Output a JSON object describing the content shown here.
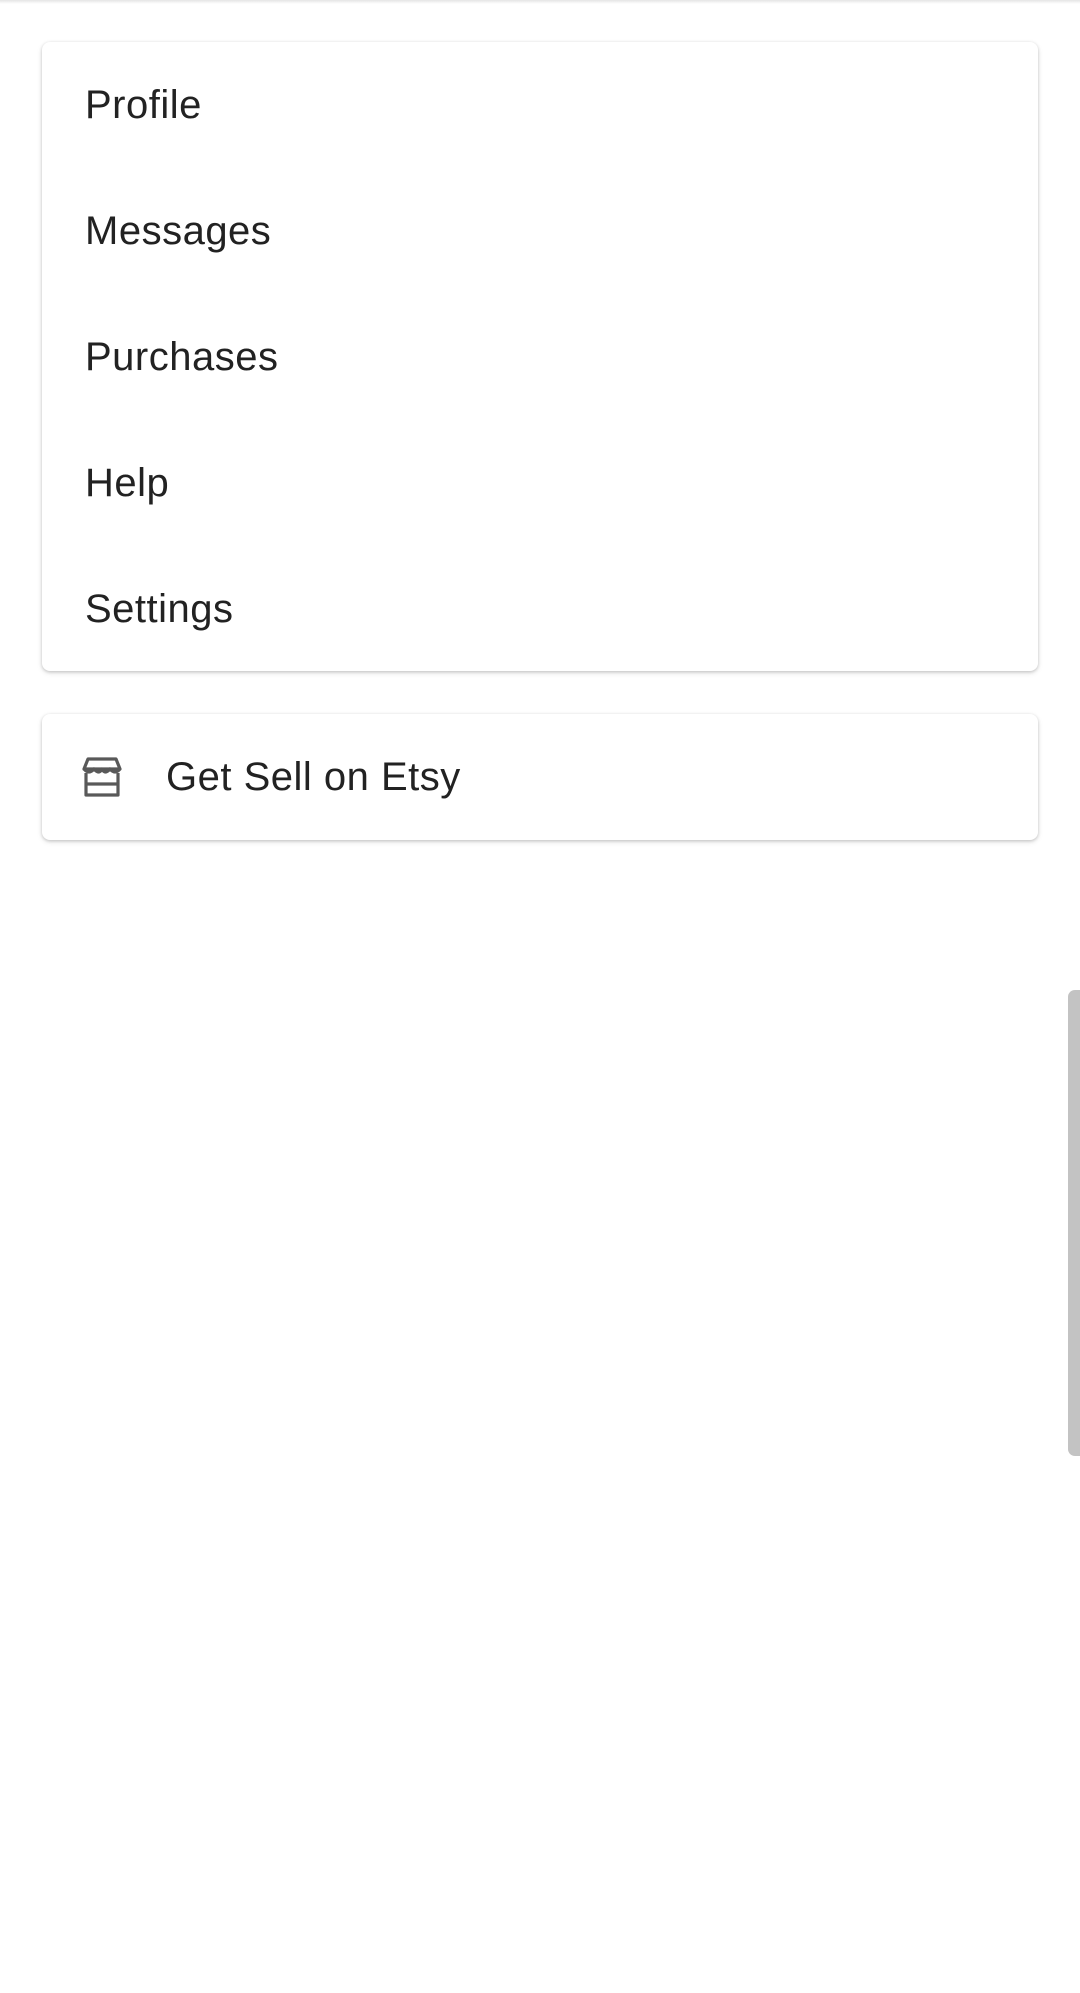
{
  "menu": {
    "items": [
      {
        "label": "Profile"
      },
      {
        "label": "Messages"
      },
      {
        "label": "Purchases"
      },
      {
        "label": "Help"
      },
      {
        "label": "Settings"
      }
    ]
  },
  "sell": {
    "icon": "shop-icon",
    "label": "Get Sell on Etsy"
  },
  "colors": {
    "text": "#222222",
    "background": "#ffffff",
    "icon": "#595959",
    "scrollbar": "#c3c3c3"
  }
}
